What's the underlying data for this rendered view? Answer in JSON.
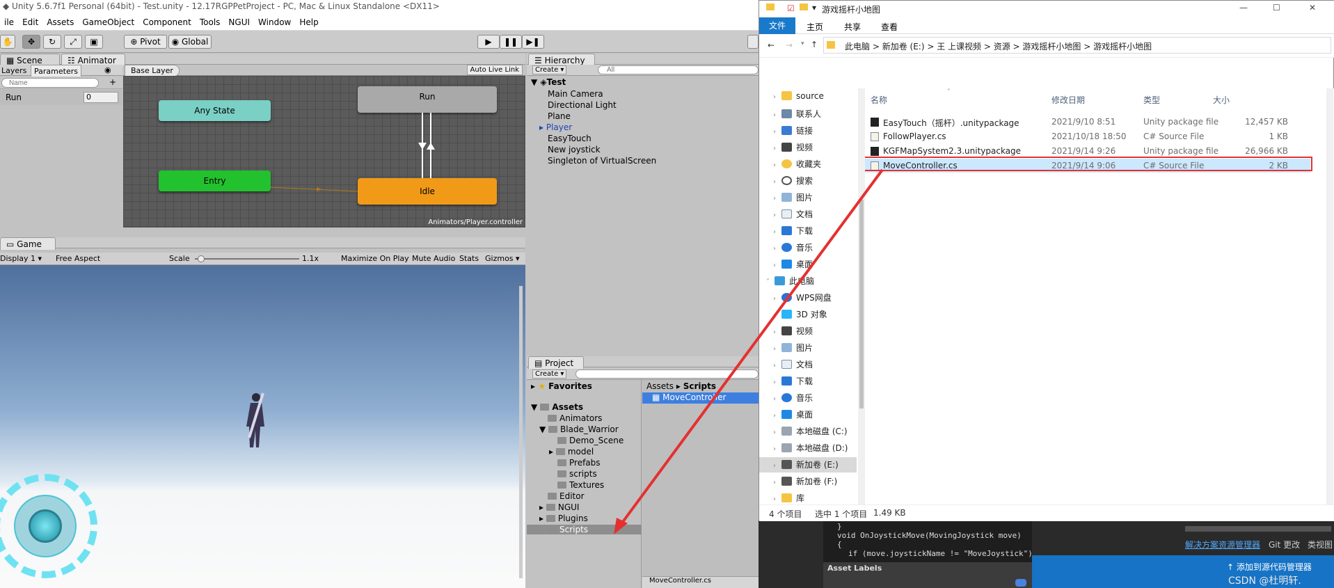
{
  "unity": {
    "title": "Unity 5.6.7f1 Personal (64bit) - Test.unity - 12.17RGPPetProject - PC, Mac & Linux Standalone <DX11>",
    "menu": [
      "ile",
      "Edit",
      "Assets",
      "GameObject",
      "Component",
      "Tools",
      "NGUI",
      "Window",
      "Help"
    ],
    "toolbar": {
      "pivot": "Pivot",
      "global": "Global"
    },
    "tabs": {
      "scene": "Scene",
      "animator": "Animator",
      "hierarchy": "Hierarchy",
      "game": "Game",
      "project": "Project"
    },
    "animator": {
      "layers_tab": "Layers",
      "params_tab": "Parameters",
      "search_placeholder": "Name",
      "base_layer": "Base Layer",
      "auto_live": "Auto Live Link",
      "param": {
        "name": "Run",
        "value": "0"
      },
      "states": {
        "any": "Any State",
        "entry": "Entry",
        "run": "Run",
        "idle": "Idle"
      },
      "footer": "Animators/Player.controller"
    },
    "hierarchy": {
      "create": "Create",
      "search_placeholder": "All",
      "scene": "Test",
      "items": [
        "Main Camera",
        "Directional Light",
        "Plane",
        "Player",
        "EasyTouch",
        "New joystick",
        "Singleton of VirtualScreen"
      ]
    },
    "game": {
      "display": "Display 1",
      "aspect": "Free Aspect",
      "scale_label": "Scale",
      "scale_value": "1.1x",
      "maximize": "Maximize On Play",
      "mute": "Mute Audio",
      "stats": "Stats",
      "gizmos": "Gizmos"
    },
    "project": {
      "create": "Create",
      "favorites": "Favorites",
      "assets": "Assets",
      "tree": [
        "Animators",
        "Blade_Warrior",
        "Demo_Scene",
        "model",
        "Prefabs",
        "scripts",
        "Textures",
        "Editor",
        "NGUI",
        "Plugins",
        "Scripts"
      ],
      "breadcrumb": {
        "root": "Assets",
        "current": "Scripts"
      },
      "file": "MoveController",
      "bottom_file": "MoveController.cs"
    }
  },
  "inspector": {
    "code": [
      "}",
      "void OnJoystickMove(MovingJoystick move)",
      "{",
      "if (move.joystickName != \"MoveJoystick\")"
    ],
    "asset_labels": "Asset Labels"
  },
  "vs": {
    "solution_explorer": "解决方案资源管理器",
    "git": "Git 更改",
    "class_view": "类视图",
    "add_source": "添加到源代码管理器",
    "watermark": "CSDN @杜明轩."
  },
  "explorer": {
    "title": "游戏摇杆小地图",
    "ribbon": [
      "文件",
      "主页",
      "共享",
      "查看"
    ],
    "path": [
      "此电脑",
      "新加卷 (E:)",
      "王 上课视频",
      "资源",
      "游戏摇杆小地图",
      "游戏摇杆小地图"
    ],
    "headers": {
      "name": "名称",
      "date": "修改日期",
      "type": "类型",
      "size": "大小"
    },
    "files": [
      {
        "name": "EasyTouch（摇杆）.unitypackage",
        "date": "2021/9/10 8:51",
        "type": "Unity package file",
        "size": "12,457 KB"
      },
      {
        "name": "FollowPlayer.cs",
        "date": "2021/10/18 18:50",
        "type": "C# Source File",
        "size": "1 KB"
      },
      {
        "name": "KGFMapSystem2.3.unitypackage",
        "date": "2021/9/14 9:26",
        "type": "Unity package file",
        "size": "26,966 KB"
      },
      {
        "name": "MoveController.cs",
        "date": "2021/9/14 9:06",
        "type": "C# Source File",
        "size": "2 KB"
      }
    ],
    "nav": [
      "source",
      "联系人",
      "链接",
      "视频",
      "收藏夹",
      "搜索",
      "图片",
      "文档",
      "下载",
      "音乐",
      "桌面",
      "此电脑",
      "WPS网盘",
      "3D 对象",
      "视频",
      "图片",
      "文档",
      "下载",
      "音乐",
      "桌面",
      "本地磁盘 (C:)",
      "本地磁盘 (D:)",
      "新加卷 (E:)",
      "新加卷 (F:)",
      "库"
    ],
    "status": {
      "count": "4 个项目",
      "selected": "选中 1 个项目",
      "size": "1.49 KB"
    }
  },
  "colors": {
    "any_state": "#7ad0c4",
    "entry": "#22c12e",
    "idle": "#f19a18",
    "run": "#a9a9a9",
    "highlight": "#3d7fe0",
    "arrow": "#e53030",
    "explorer_accent": "#1979ca"
  }
}
